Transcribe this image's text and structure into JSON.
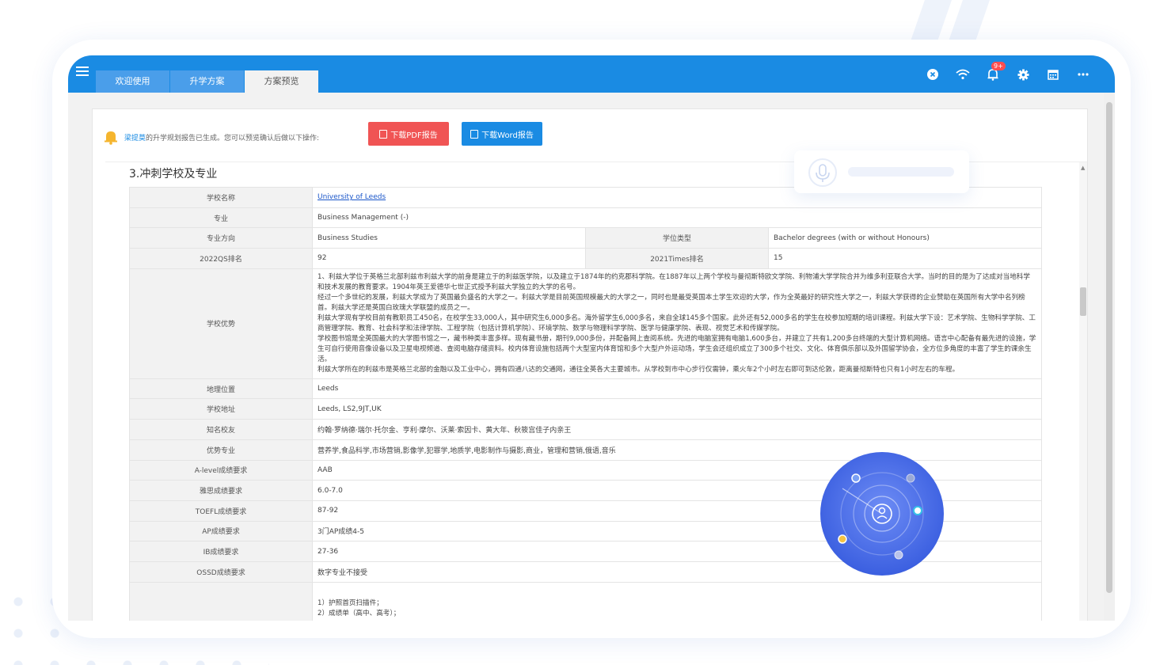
{
  "tabs": [
    {
      "label": "欢迎使用",
      "active": false
    },
    {
      "label": "升学方案",
      "active": false
    },
    {
      "label": "方案预览",
      "active": true
    }
  ],
  "topbar": {
    "notification_badge": "9+",
    "bar_color": "#1a8be3"
  },
  "notice": {
    "user": "梁提莫",
    "text": "的升学规划报告已生成。您可以预览确认后做以下操作:",
    "pdf_button": "下载PDF报告",
    "word_button": "下载Word报告"
  },
  "section_title": "3.冲刺学校及专业",
  "table": {
    "school_name_label": "学校名称",
    "school_name": "University of Leeds",
    "major_label": "专业",
    "major": "Business Management (-)",
    "direction_label": "专业方向",
    "direction": "Business Studies",
    "degree_type_label": "学位类型",
    "degree_type": "Bachelor degrees (with or without Honours)",
    "qs_label": "2022QS排名",
    "qs": "92",
    "times_label": "2021Times排名",
    "times": "15",
    "advantage_label": "学校优势",
    "advantage_paragraphs": [
      "1、利兹大学位于英格兰北部利兹市利兹大学的前身是建立于的利兹医学院，以及建立于1874年的约克郡科学院。在1887年以上两个学校与曼彻斯特欧文学院、利物浦大学学院合并为维多利亚联合大学。当时的目的是为了达成对当地科学和技术发展的教育要求。1904年英王爱德华七世正式授予利兹大学独立的大学的名号。",
      "经过一个多世纪的发展，利兹大学成为了英国最负盛名的大学之一。利兹大学是目前英国规模最大的大学之一，同时也是最受英国本土学生欢迎的大学，作为全英最好的研究性大学之一，利兹大学获得的企业赞助在英国所有大学中名列榜首。利兹大学还是英国白玫瑰大学联盟的成员之一。",
      "利兹大学现有学校目前有教职员工450名，在校学生33,000人，其中研究生6,000多名。海外留学生6,000多名，来自全球145多个国家。此外还有52,000多名的学生在校参加短期的培训课程。利兹大学下设：艺术学院、生物科学学院、工商管理学院、教育、社会科学和法律学院、工程学院（包括计算机学院）、环境学院、数学与物理科学学院、医学与健康学院、表现、视觉艺术和传媒学院。",
      "学校图书馆是全英国最大的大学图书馆之一，藏书种类丰富多样。现有藏书册，期刊9,000多份，并配备网上查阅系统。先进的电脑室拥有电脑1,600多台，并建立了共有1,200多台终端的大型计算机网络。语言中心配备有最先进的设施，学生可自行使用音像设备以及卫星电视频道、查阅电脑存储资料。校内体育设施包括两个大型室内体育馆和多个大型户外运动场，学生会还组织成立了300多个社交、文化、体育俱乐部以及外国留学协会，全方位多角度的丰富了学生的课余生活。",
      "利兹大学所在的利兹市是英格兰北部的金融以及工业中心，拥有四通八达的交通网，通往全英各大主要城市。从学校到市中心步行仅需钟，乘火车2个小时左右即可到达伦敦，距离曼彻斯特也只有1小时左右的车程。"
    ],
    "location_label": "地理位置",
    "location": "Leeds",
    "address_label": "学校地址",
    "address": "Leeds, LS2,9JT,UK",
    "alumni_label": "知名校友",
    "alumni": "约翰·罗纳德·瑞尔·托尔金、亨利·摩尔、沃莱·索因卡、黄大年、秋筱宫佳子内亲王",
    "strong_majors_label": "优势专业",
    "strong_majors": "营养学,食品科学,市场营销,影像学,犯罪学,地质学,电影制作与摄影,商业，管理和营销,俄语,音乐",
    "alevel_label": "A-level成绩要求",
    "alevel": "AAB",
    "ielts_label": "雅思成绩要求",
    "ielts": "6.0-7.0",
    "toefl_label": "TOEFL成绩要求",
    "toefl": "87-92",
    "ap_label": "AP成绩要求",
    "ap": "3门AP成绩4-5",
    "ib_label": "IB成绩要求",
    "ib": "27-36",
    "ossd_label": "OSSD成绩要求",
    "ossd": "数字专业不接受",
    "materials": [
      "1）护照首页扫描件；",
      "2）成绩单（高中、高考）；"
    ]
  }
}
